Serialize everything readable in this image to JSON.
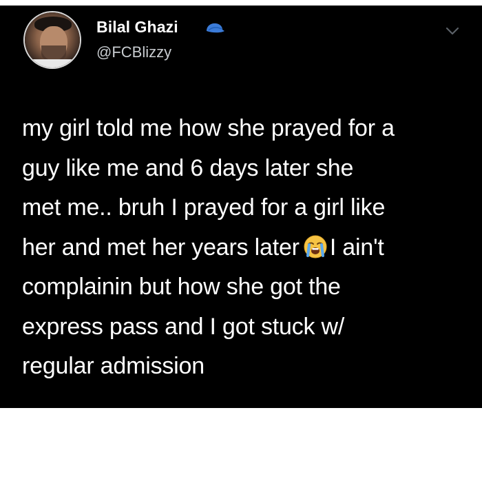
{
  "tweet": {
    "author": {
      "display_name": "Bilal Ghazi",
      "handle": "@FCBlizzy",
      "badge_icon": "blue-cap-icon",
      "avatar_icon": "profile-photo"
    },
    "menu_icon": "chevron-down-icon",
    "text_lines": [
      "my girl told me how she prayed for a",
      "guy like me and 6 days later she",
      "met me.. bruh I prayed for a girl like",
      "her and met her years later",
      "I ain't",
      "complainin but how she got the",
      "express pass and I got stuck w/",
      "regular admission"
    ],
    "emoji": {
      "name": "loudly-crying-face-emoji",
      "char": "😭"
    }
  },
  "colors": {
    "card_background": "#000000",
    "page_background": "#ffffff",
    "text_primary": "#ffffff",
    "text_secondary": "#c8ccd0",
    "badge_blue": "#3b7bd8"
  }
}
